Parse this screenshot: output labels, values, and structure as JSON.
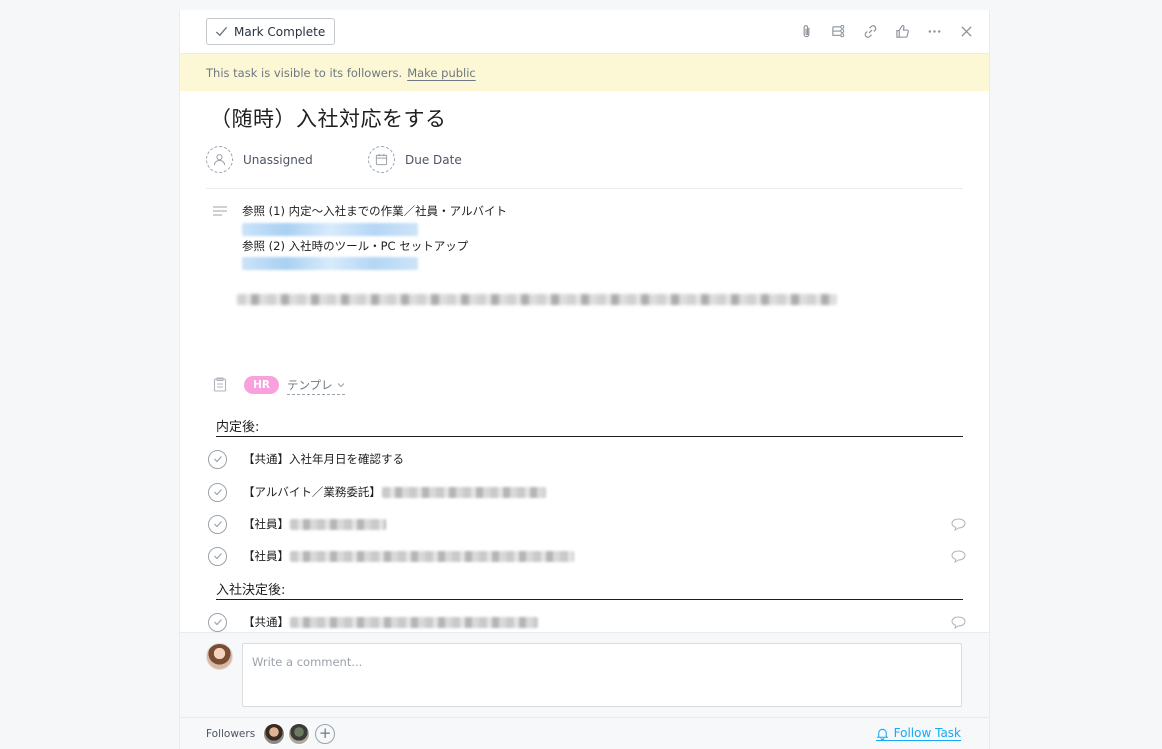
{
  "toolbar": {
    "mark_complete_label": "Mark Complete",
    "icons": [
      "paperclip-icon",
      "subtask-icon",
      "link-icon",
      "like-icon",
      "more-icon",
      "close-icon"
    ]
  },
  "banner": {
    "text": "This task is visible to its followers.",
    "link": "Make public"
  },
  "task": {
    "title": "（随時）入社対応をする",
    "assignee": "Unassigned",
    "due_date": "Due Date",
    "description": {
      "line1": "参照 (1) 内定〜入社までの作業／社員・アルバイト",
      "line2": "参照 (2) 入社時のツール・PC セットアップ"
    },
    "tag": "HR",
    "project": "テンプレ"
  },
  "sections": [
    {
      "title": "内定後:",
      "subtasks": [
        {
          "label": "【共通】入社年月日を確認する",
          "has_comment": false
        },
        {
          "label": "【アルバイト／業務委託】",
          "has_comment": false
        },
        {
          "label": "【社員】",
          "has_comment": true
        },
        {
          "label": "【社員】",
          "has_comment": true
        }
      ]
    },
    {
      "title": "入社決定後:",
      "subtasks": [
        {
          "label": "【共通】",
          "has_comment": true
        }
      ]
    }
  ],
  "comment": {
    "placeholder": "Write a comment..."
  },
  "footer": {
    "followers_label": "Followers",
    "follow_label": "Follow Task"
  },
  "colors": {
    "banner_bg": "#fcf8d5",
    "tag_hr": "#f8a1dd",
    "link_blue": "#14aaf5"
  }
}
